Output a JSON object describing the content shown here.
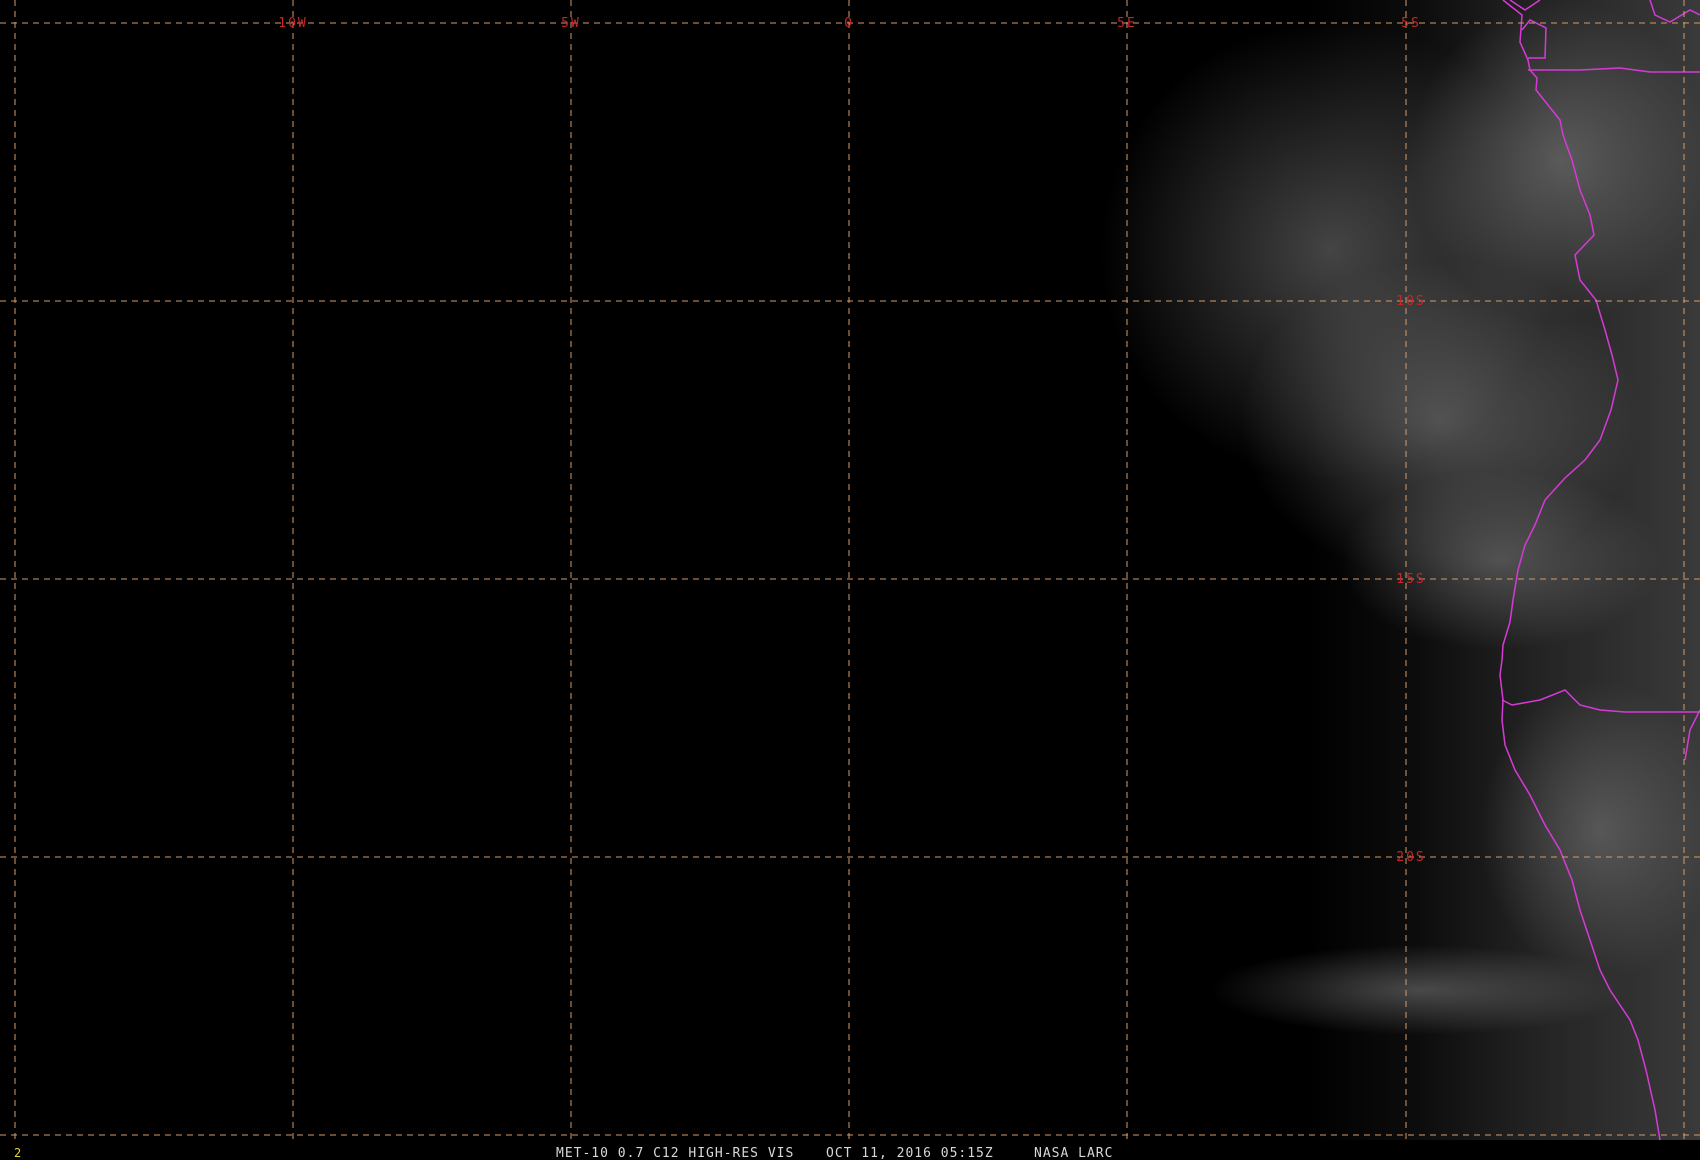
{
  "map": {
    "longitude_labels": [
      "10W",
      "5W",
      "0",
      "5E"
    ],
    "latitude_labels": [
      "5S",
      "10S",
      "15S",
      "20S"
    ],
    "colors": {
      "background": "#000000",
      "grid": "#d49a6a",
      "grid_labels": "#c42828",
      "political_borders": "#d63ad6",
      "caption": "#d8d8d8",
      "frame_number": "#e0d83a"
    }
  },
  "footer": {
    "frame_number": "2",
    "product": "MET-10 0.7 C12 HIGH-RES VIS",
    "timestamp": "OCT 11, 2016 05:15Z",
    "source": "NASA LARC"
  }
}
